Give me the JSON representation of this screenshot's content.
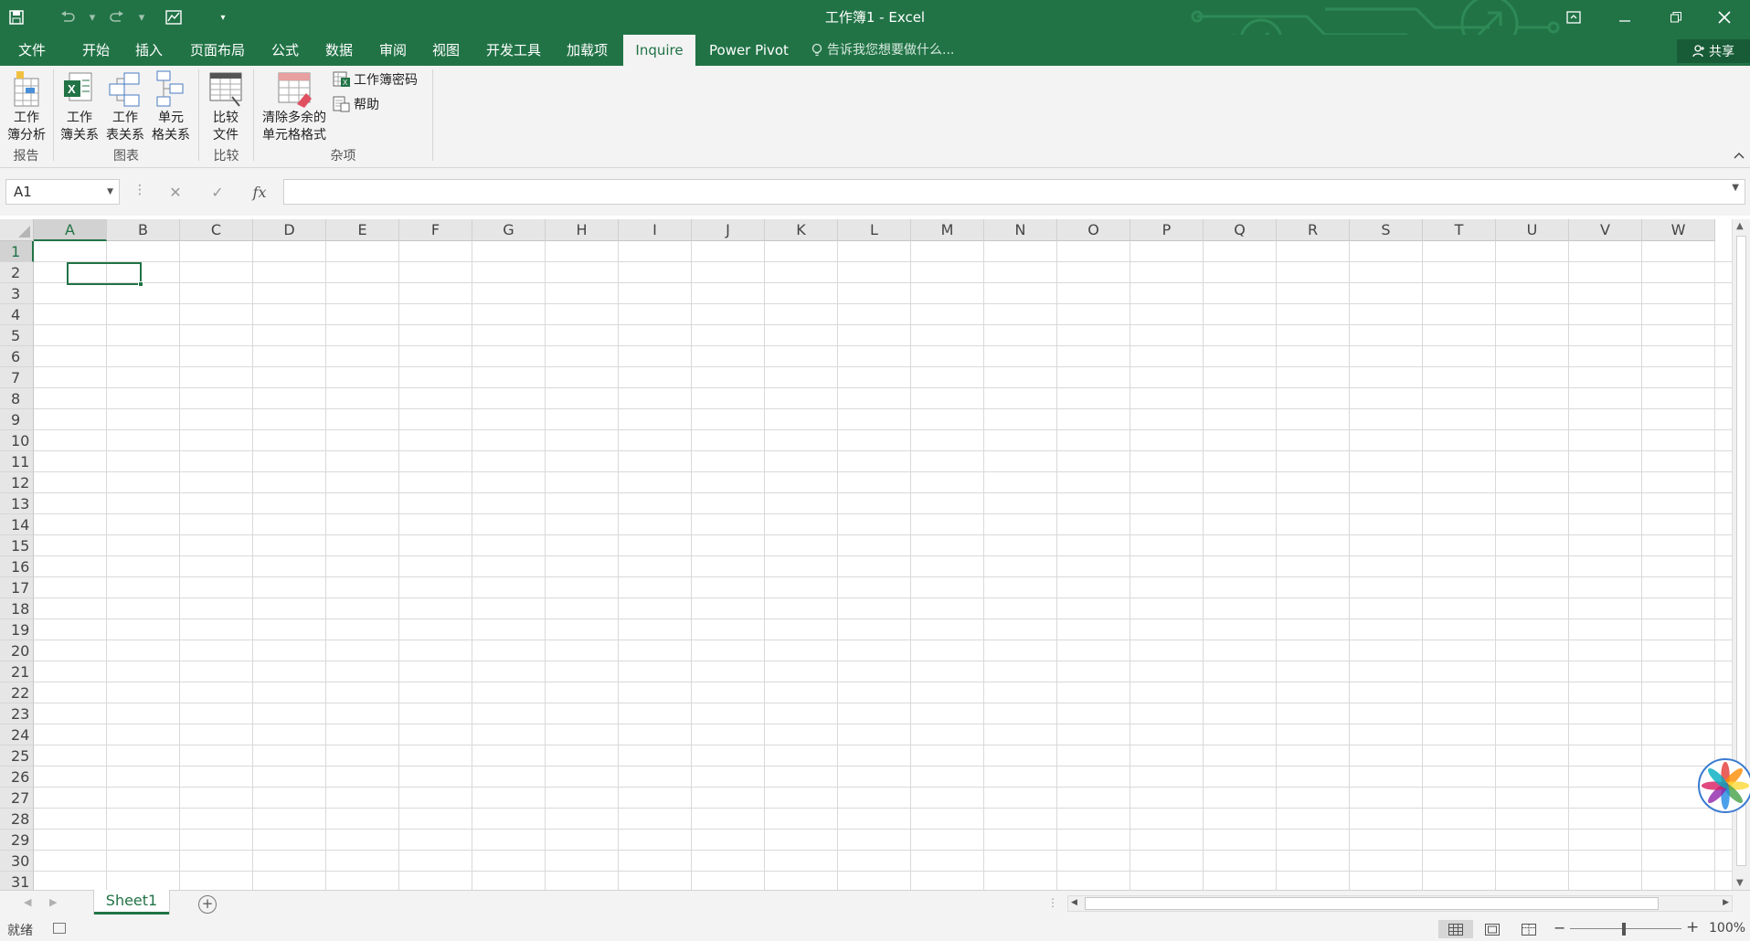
{
  "window": {
    "title": "工作簿1 - Excel",
    "accent_color": "#217346"
  },
  "qat": {
    "icons": [
      "save-icon",
      "undo-icon",
      "redo-icon",
      "customize-icon",
      "dropdown-icon"
    ]
  },
  "tabs": [
    {
      "label": "文件"
    },
    {
      "label": "开始"
    },
    {
      "label": "插入"
    },
    {
      "label": "页面布局"
    },
    {
      "label": "公式"
    },
    {
      "label": "数据"
    },
    {
      "label": "审阅"
    },
    {
      "label": "视图"
    },
    {
      "label": "开发工具"
    },
    {
      "label": "加载项"
    },
    {
      "label": "Inquire",
      "active": true
    },
    {
      "label": "Power Pivot"
    }
  ],
  "tell_me": {
    "placeholder": "告诉我您想要做什么..."
  },
  "share": {
    "label": "共享"
  },
  "ribbon": {
    "groups": [
      {
        "name": "报告",
        "buttons": [
          {
            "line1": "工作",
            "line2": "簿分析"
          }
        ]
      },
      {
        "name": "图表",
        "buttons": [
          {
            "line1": "工作",
            "line2": "簿关系"
          },
          {
            "line1": "工作",
            "line2": "表关系"
          },
          {
            "line1": "单元",
            "line2": "格关系"
          }
        ]
      },
      {
        "name": "比较",
        "buttons": [
          {
            "line1": "比较",
            "line2": "文件"
          }
        ]
      },
      {
        "name": "杂项",
        "buttons": [
          {
            "line1": "清除多余的",
            "line2": "单元格格式"
          }
        ],
        "small_buttons": [
          {
            "label": "工作簿密码"
          },
          {
            "label": "帮助"
          }
        ]
      }
    ]
  },
  "formula_bar": {
    "name_box": "A1",
    "fx_label": "fx",
    "formula": ""
  },
  "grid": {
    "columns": [
      "A",
      "B",
      "C",
      "D",
      "E",
      "F",
      "G",
      "H",
      "I",
      "J",
      "K",
      "L",
      "M",
      "N",
      "O",
      "P",
      "Q",
      "R",
      "S",
      "T",
      "U",
      "V",
      "W"
    ],
    "rows": [
      "1",
      "2",
      "3",
      "4",
      "5",
      "6",
      "7",
      "8",
      "9",
      "10",
      "11",
      "12",
      "13",
      "14",
      "15",
      "16",
      "17",
      "18",
      "19",
      "20",
      "21",
      "22",
      "23",
      "24",
      "25",
      "26",
      "27",
      "28",
      "29",
      "30",
      "31"
    ],
    "selected_cell": "A1"
  },
  "sheets": [
    {
      "name": "Sheet1",
      "active": true
    }
  ],
  "status": {
    "text": "就绪",
    "zoom": "100%"
  }
}
